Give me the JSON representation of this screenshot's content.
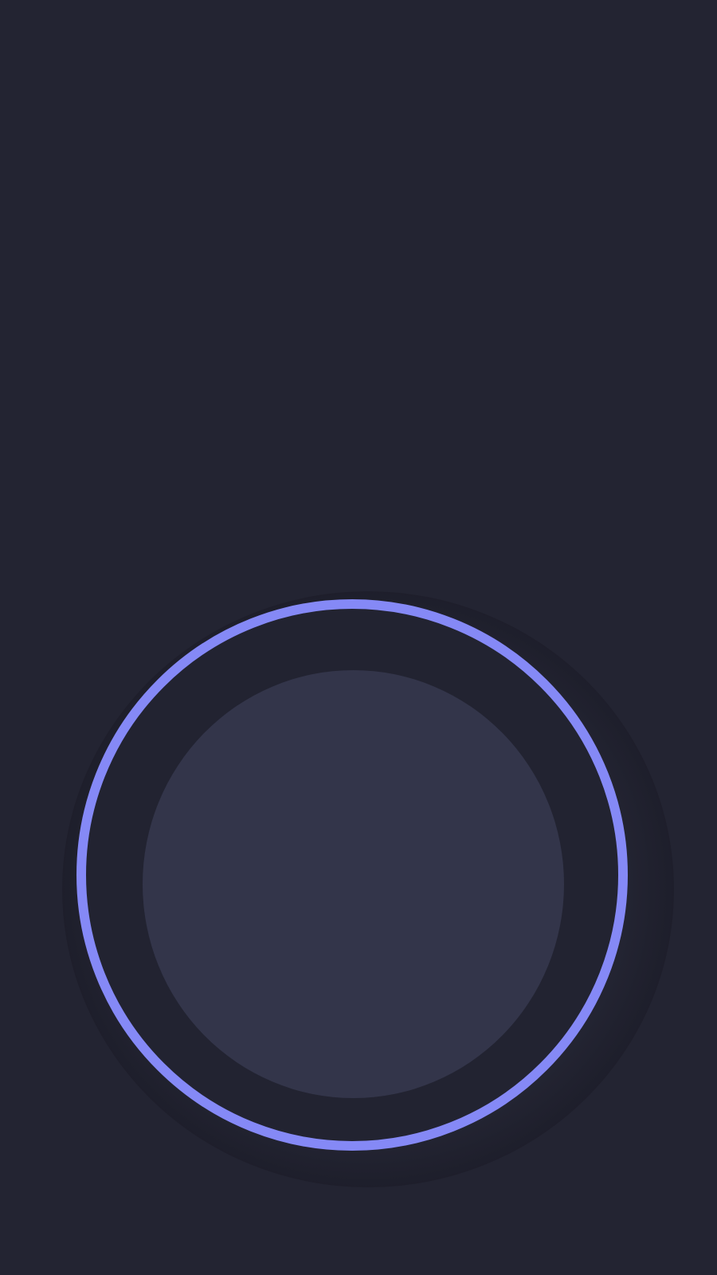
{
  "colors": {
    "background": "#232432",
    "ring_accent": "#8589f6",
    "ring_fill": "#222331",
    "core": "#33354a"
  },
  "controls": {
    "main_button": {
      "icon": "circle-button-icon"
    }
  }
}
